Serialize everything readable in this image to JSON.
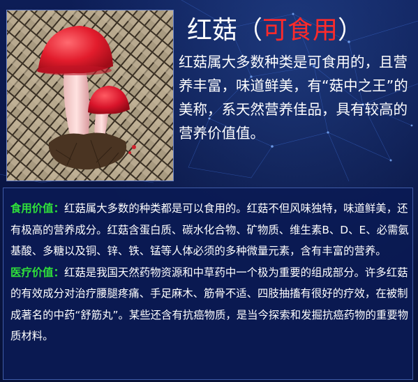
{
  "title": {
    "main": "红菇（",
    "highlight": "可食用",
    "close": "）"
  },
  "intro": "红菇属大多数种类是可食用的，且营养丰富，味道鲜美，有“菇中之王”的美称，系天然营养佳品，具有较高的营养价值值。",
  "sections": [
    {
      "label": "食用价值：",
      "text": "红菇属大多数的种类都是可以食用的。红菇不但风味独特，味道鲜美，还有极高的营养成分。红菇含蛋白质、碳水化合物、矿物质、维生素B、D、E、必需氨基酸、多糖以及铜、锌、铁、锰等人体必须的多种微量元素，含有丰富的营养。"
    },
    {
      "label": "医疗价值：",
      "text": "红菇是我国天然药物资源和中草药中一个极为重要的组成部分。许多红菇的有效成分对治疗腰腿疼痛、手足麻木、筋骨不适、四肢抽搐有很好的疗效，在被制成著名的中药“舒筋丸”。某些还含有抗癌物质，是当今探索和发掘抗癌药物的重要物质材料。"
    }
  ],
  "colors": {
    "background": "#0a1540",
    "accent_red": "#ff2a2a",
    "label_green": "#2fe03a",
    "text": "#ffffff"
  },
  "icons": {
    "photo": "red-mushroom-photo"
  }
}
